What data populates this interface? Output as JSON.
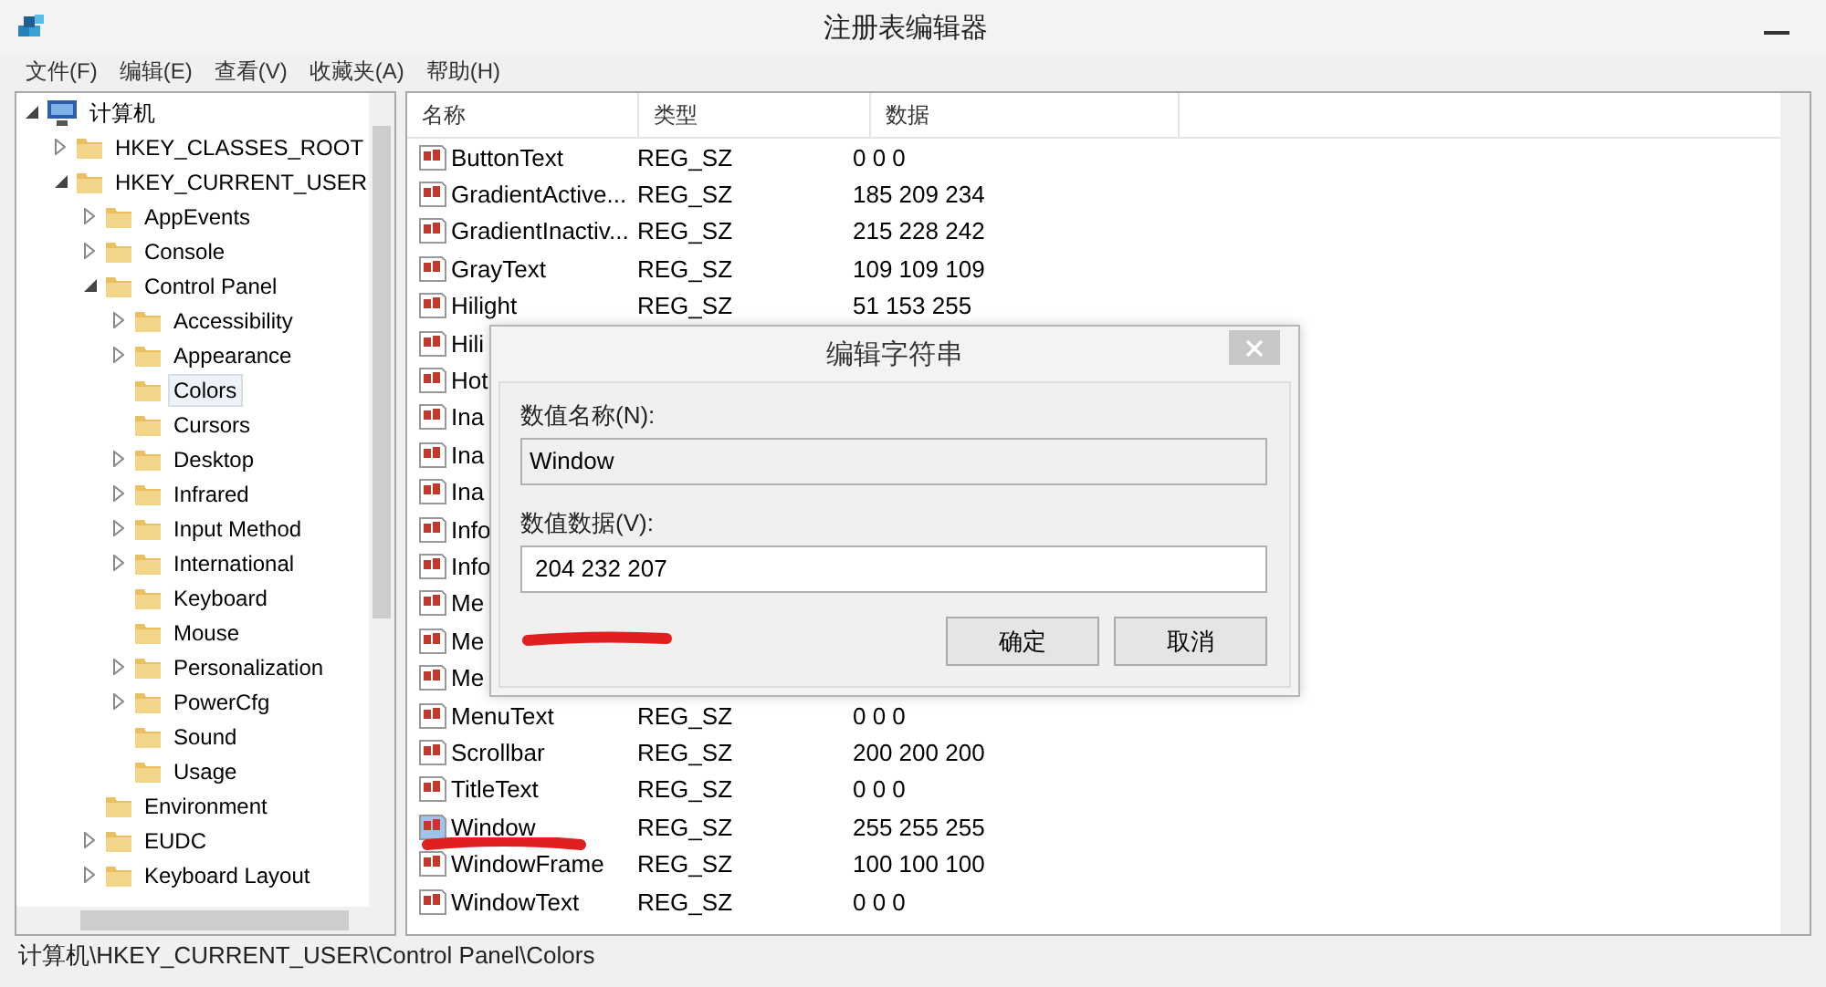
{
  "window": {
    "title": "注册表编辑器"
  },
  "menu": [
    "文件(F)",
    "编辑(E)",
    "查看(V)",
    "收藏夹(A)",
    "帮助(H)"
  ],
  "tree": [
    {
      "label": "计算机",
      "expanded": true,
      "selected": false,
      "children": [
        {
          "label": "HKEY_CLASSES_ROOT",
          "expanded": false,
          "selected": false
        },
        {
          "label": "HKEY_CURRENT_USER",
          "expanded": true,
          "selected": false,
          "children": [
            {
              "label": "AppEvents",
              "expanded": false,
              "selected": false
            },
            {
              "label": "Console",
              "expanded": false,
              "selected": false
            },
            {
              "label": "Control Panel",
              "expanded": true,
              "selected": false,
              "children": [
                {
                  "label": "Accessibility",
                  "expanded": false,
                  "selected": false
                },
                {
                  "label": "Appearance",
                  "expanded": false,
                  "selected": false
                },
                {
                  "label": "Colors",
                  "selected": true
                },
                {
                  "label": "Cursors",
                  "selected": false
                },
                {
                  "label": "Desktop",
                  "expanded": false,
                  "selected": false
                },
                {
                  "label": "Infrared",
                  "expanded": false,
                  "selected": false
                },
                {
                  "label": "Input Method",
                  "expanded": false,
                  "selected": false
                },
                {
                  "label": "International",
                  "expanded": false,
                  "selected": false
                },
                {
                  "label": "Keyboard",
                  "selected": false
                },
                {
                  "label": "Mouse",
                  "selected": false
                },
                {
                  "label": "Personalization",
                  "expanded": false,
                  "selected": false
                },
                {
                  "label": "PowerCfg",
                  "expanded": false,
                  "selected": false
                },
                {
                  "label": "Sound",
                  "selected": false
                },
                {
                  "label": "Usage",
                  "selected": false
                }
              ]
            },
            {
              "label": "Environment",
              "selected": false
            },
            {
              "label": "EUDC",
              "expanded": false,
              "selected": false
            },
            {
              "label": "Keyboard Layout",
              "expanded": false,
              "selected": false
            }
          ]
        }
      ]
    }
  ],
  "table": {
    "columns": [
      "名称",
      "类型",
      "数据"
    ],
    "rows": [
      {
        "name": "ButtonText",
        "type": "REG_SZ",
        "data": "0 0 0",
        "selected": false
      },
      {
        "name": "GradientActive...",
        "type": "REG_SZ",
        "data": "185 209 234",
        "selected": false
      },
      {
        "name": "GradientInactiv...",
        "type": "REG_SZ",
        "data": "215 228 242",
        "selected": false
      },
      {
        "name": "GrayText",
        "type": "REG_SZ",
        "data": "109 109 109",
        "selected": false
      },
      {
        "name": "Hilight",
        "type": "REG_SZ",
        "data": "51 153 255",
        "selected": false
      },
      {
        "name": "Hili",
        "selected": false
      },
      {
        "name": "Hot",
        "selected": false
      },
      {
        "name": "Ina",
        "selected": false
      },
      {
        "name": "Ina",
        "selected": false
      },
      {
        "name": "Ina",
        "selected": false
      },
      {
        "name": "Info",
        "selected": false
      },
      {
        "name": "Info",
        "selected": false
      },
      {
        "name": "Me",
        "selected": false
      },
      {
        "name": "Me",
        "selected": false
      },
      {
        "name": "Me",
        "selected": false
      },
      {
        "name": "MenuText",
        "type": "REG_SZ",
        "data": "0 0 0",
        "selected": false
      },
      {
        "name": "Scrollbar",
        "type": "REG_SZ",
        "data": "200 200 200",
        "selected": false
      },
      {
        "name": "TitleText",
        "type": "REG_SZ",
        "data": "0 0 0",
        "selected": false
      },
      {
        "name": "Window",
        "type": "REG_SZ",
        "data": "255 255 255",
        "selected": true
      },
      {
        "name": "WindowFrame",
        "type": "REG_SZ",
        "data": "100 100 100",
        "selected": false
      },
      {
        "name": "WindowText",
        "type": "REG_SZ",
        "data": "0 0 0",
        "selected": false
      }
    ]
  },
  "status_bar": "计算机\\HKEY_CURRENT_USER\\Control Panel\\Colors",
  "dialog": {
    "title": "编辑字符串",
    "name_label": "数值名称(N):",
    "name_value": "Window",
    "data_label": "数值数据(V):",
    "data_value": "204 232 207",
    "buttons": [
      "确定",
      "取消"
    ]
  }
}
